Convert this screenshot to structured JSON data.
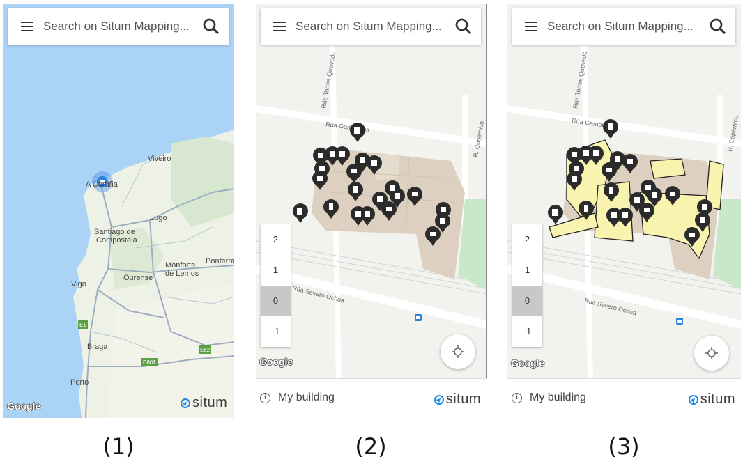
{
  "search": {
    "placeholder": "Search on Situm Mapping..."
  },
  "map_labels": {
    "panel1": [
      "Viveiro",
      "A Coruña",
      "Lugo",
      "Santiago de Compostela",
      "Monforte de Lemos",
      "Ponferrada",
      "Vigo",
      "Ourense",
      "Braga",
      "Porto"
    ],
    "road_badges": [
      "E1",
      "E82",
      "E801"
    ],
    "streets": [
      "Rúa Torres Quevedo",
      "Rúa Gambrinus",
      "R. Copérnico",
      "Rúa Severo Ochoa"
    ]
  },
  "floors": [
    "2",
    "1",
    "0",
    "-1"
  ],
  "selected_floor": "0",
  "bottom_bar": {
    "building": "My building"
  },
  "brand": {
    "google": "Google",
    "situm": "situm"
  },
  "captions": [
    "(1)",
    "(2)",
    "(3)"
  ],
  "colors": {
    "map_water": "#aad3f6",
    "building_floorplan": "#ddd0c0",
    "highlight_zone": "#f8f4b0",
    "poi_marker": "#2b2b2b",
    "user_location": "#2f7fe0",
    "park": "#c9e8c9"
  }
}
